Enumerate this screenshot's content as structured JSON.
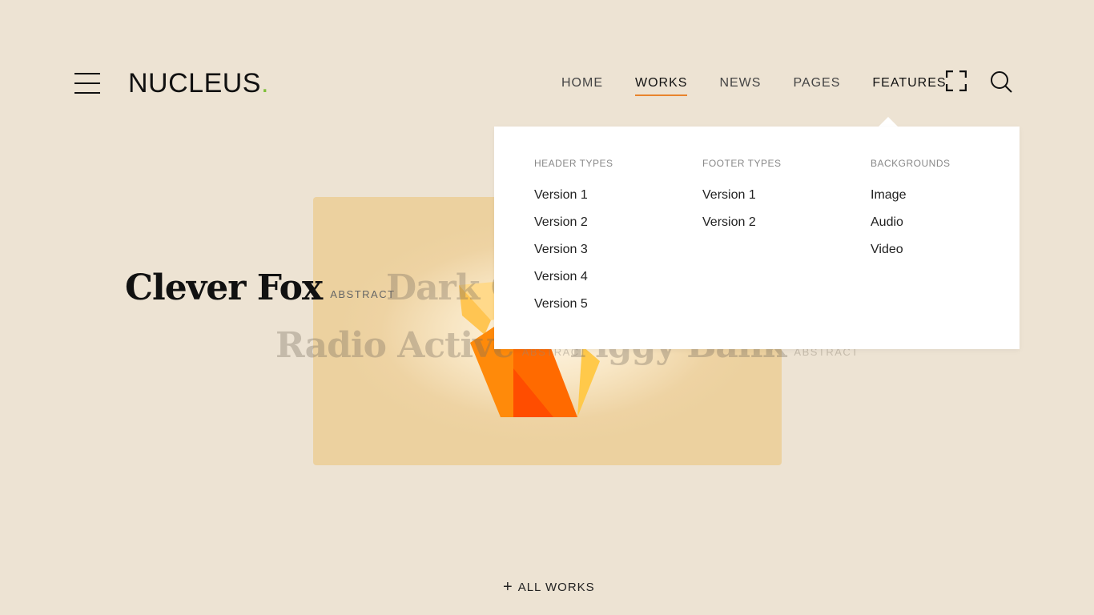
{
  "brand": {
    "name": "NUCLEUS",
    "dot": ".",
    "dot_color": "#7fbf3a"
  },
  "accent_color": "#e8842c",
  "nav": {
    "items": [
      {
        "label": "HOME",
        "active": false
      },
      {
        "label": "WORKS",
        "active": true
      },
      {
        "label": "NEWS",
        "active": false
      },
      {
        "label": "PAGES",
        "active": false
      },
      {
        "label": "FEATURES",
        "active": false
      }
    ],
    "icons": [
      "menu-icon",
      "fullscreen-icon",
      "search-icon"
    ]
  },
  "dropdown": {
    "columns": [
      {
        "heading": "HEADER TYPES",
        "links": [
          "Version 1",
          "Version 2",
          "Version 3",
          "Version 4",
          "Version 5"
        ]
      },
      {
        "heading": "FOOTER TYPES",
        "links": [
          "Version 1",
          "Version 2"
        ]
      },
      {
        "heading": "BACKGROUNDS",
        "links": [
          "Image",
          "Audio",
          "Video"
        ]
      }
    ]
  },
  "works": [
    {
      "title": "Clever Fox",
      "category": "ABSTRACT"
    },
    {
      "title": "Dark Crow",
      "category": ""
    },
    {
      "title": "Radio Active",
      "category": "ABSTRACT"
    },
    {
      "title": "Piggy Bank",
      "category": "ABSTRACT"
    }
  ],
  "all_works": {
    "plus": "+",
    "label": "ALL WORKS"
  }
}
